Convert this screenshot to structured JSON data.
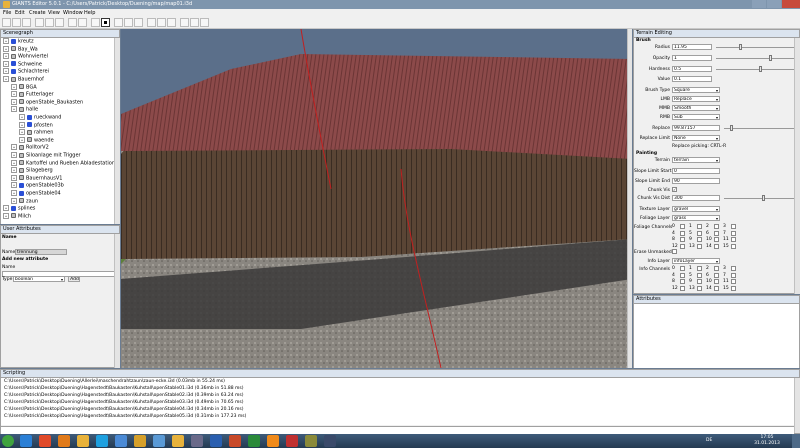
{
  "window": {
    "title": "GIANTS Editor 5.0.1 - C:/Users/Patrick/Desktop/Duening/map/map01.i3d"
  },
  "menu": [
    "File",
    "Edit",
    "Create",
    "View",
    "Window",
    "Help"
  ],
  "scenegraph": {
    "title": "Scenegraph",
    "items": [
      {
        "label": "kreutz",
        "depth": 0,
        "icon": "node-icon"
      },
      {
        "label": "Bay_Wa",
        "depth": 0,
        "icon": "group-icon"
      },
      {
        "label": "Wohnviertel",
        "depth": 0,
        "icon": "group-icon"
      },
      {
        "label": "Schweine",
        "depth": 0,
        "icon": "node-icon"
      },
      {
        "label": "Schlachterei",
        "depth": 0,
        "icon": "node-icon"
      },
      {
        "label": "Bauernhof",
        "depth": 0,
        "icon": "group-icon"
      },
      {
        "label": "BGA",
        "depth": 1,
        "icon": "group-icon"
      },
      {
        "label": "Futterlager",
        "depth": 1,
        "icon": "group-icon"
      },
      {
        "label": "openStable_Baukasten",
        "depth": 1,
        "icon": "group-icon"
      },
      {
        "label": "halle",
        "depth": 1,
        "icon": "group-icon"
      },
      {
        "label": "rueckwand",
        "depth": 2,
        "icon": "node-icon"
      },
      {
        "label": "pfosten",
        "depth": 2,
        "icon": "node-icon"
      },
      {
        "label": "rahmen",
        "depth": 2,
        "icon": "group-icon"
      },
      {
        "label": "waende",
        "depth": 2,
        "icon": "group-icon"
      },
      {
        "label": "RolltorV2",
        "depth": 1,
        "icon": "group-icon"
      },
      {
        "label": "Siloanlage mit Trigger",
        "depth": 1,
        "icon": "group-icon"
      },
      {
        "label": "Kartoffel und Rueben Abladestation",
        "depth": 1,
        "icon": "group-icon"
      },
      {
        "label": "Silageberg",
        "depth": 1,
        "icon": "group-icon"
      },
      {
        "label": "BauernhausV1",
        "depth": 1,
        "icon": "group-icon"
      },
      {
        "label": "openStable03b",
        "depth": 1,
        "icon": "node-icon"
      },
      {
        "label": "openStable04",
        "depth": 1,
        "icon": "node-icon"
      },
      {
        "label": "zaun",
        "depth": 1,
        "icon": "group-icon"
      },
      {
        "label": "splines",
        "depth": 0,
        "icon": "node-icon"
      },
      {
        "label": "Milch",
        "depth": 0,
        "icon": "group-icon"
      }
    ]
  },
  "user_attributes": {
    "title": "User Attributes",
    "name_header": "Name",
    "name_label": "Name",
    "name_value": "trennung",
    "add_new_header": "Add new attribute",
    "new_name_label": "Name",
    "type_label": "Type",
    "type_value": "boolean",
    "add_button": "Add"
  },
  "terrain": {
    "title": "Terrain Editing",
    "brush_header": "Brush",
    "radius_label": "Radius",
    "radius_value": "11.95",
    "opacity_label": "Opacity",
    "opacity_value": "1",
    "hardness_label": "Hardness",
    "hardness_value": "0.5",
    "value_label": "Value",
    "value_value": "0.1",
    "brush_type_label": "Brush Type",
    "brush_type_value": "Square",
    "lmb_label": "LMB",
    "lmb_value": "Replace",
    "mmb_label": "MMB",
    "mmb_value": "Smooth",
    "rmb_label": "RMB",
    "rmb_value": "Sub",
    "replace_label": "Replace",
    "replace_value": "99.87157",
    "replace_limit_label": "Replace Limit",
    "replace_limit_value": "None",
    "replace_picking": "Replace picking: CRTL-R",
    "painting_header": "Painting",
    "terrain_label": "Terrain",
    "terrain_value": "terrain",
    "slope_start_label": "Slope Limit Start",
    "slope_start_value": "0",
    "slope_end_label": "Slope Limit End",
    "slope_end_value": "90",
    "chunk_vis_label": "Chunk Vis",
    "chunk_vis_dist_label": "Chunk Vis Dist",
    "chunk_vis_dist_value": "300",
    "texture_layer_label": "Texture Layer",
    "texture_layer_value": "gravel",
    "foliage_layer_label": "Foliage Layer",
    "foliage_layer_value": "grass",
    "foliage_channels_label": "Foliage Channels",
    "foliage_channels": [
      "0",
      "1",
      "2",
      "3",
      "4",
      "5",
      "6",
      "7",
      "8",
      "9",
      "10",
      "11",
      "12",
      "13",
      "14",
      "15"
    ],
    "erase_unmasked_label": "Erase Unmasked",
    "info_layer_label": "Info Layer",
    "info_layer_value": "infoLayer",
    "info_channels_label": "Info Channels",
    "info_channels": [
      "0",
      "1",
      "2",
      "3",
      "4",
      "5",
      "6",
      "7",
      "8",
      "9",
      "10",
      "11",
      "12",
      "13",
      "14",
      "15"
    ]
  },
  "attributes_panel": {
    "title": "Attributes"
  },
  "scripting": {
    "title": "Scripting",
    "lines": [
      "C:\\Users\\Patrick\\Desktop\\Duening\\Allerlei\\maschendrahtzaun\\zaun-ecke.i3d (0.03mb in 55.24 ms)",
      "C:\\Users\\Patrick\\Desktop\\Duening\\Hagenstedt\\Baukasten\\Kuhstall\\openStable01.i3d (0.36mb in 51.88 ms)",
      "C:\\Users\\Patrick\\Desktop\\Duening\\Hagenstedt\\Baukasten\\Kuhstall\\openStable02.i3d (0.39mb in 63.24 ms)",
      "C:\\Users\\Patrick\\Desktop\\Duening\\Hagenstedt\\Baukasten\\Kuhstall\\openStable03.i3d (0.49mb in 70.65 ms)",
      "C:\\Users\\Patrick\\Desktop\\Duening\\Hagenstedt\\Baukasten\\Kuhstall\\openStable04.i3d (0.34mb in 20.16 ms)",
      "C:\\Users\\Patrick\\Desktop\\Duening\\Hagenstedt\\Baukasten\\Kuhstall\\openStable05.i3d (0.31mb in 177.23 ms)"
    ]
  },
  "taskbar": {
    "time": "17:05",
    "date": "31.01.2013",
    "lang": "DE",
    "apps": [
      "start-orb-icon",
      "ie-icon",
      "chrome-icon",
      "firefox-icon",
      "explorer-icon",
      "skype-icon",
      "photo-icon",
      "media-icon",
      "notepad-icon",
      "giants-icon",
      "teamspeak-icon",
      "word-icon",
      "powerpoint-icon",
      "excel-icon",
      "vlc-icon",
      "calendar-icon",
      "tractor-icon",
      "steam-icon"
    ]
  },
  "colors": {
    "accent": "#dbe4ef",
    "roof": "#8c4a4a",
    "wall": "#5a4535",
    "ground": "#8a8680"
  }
}
